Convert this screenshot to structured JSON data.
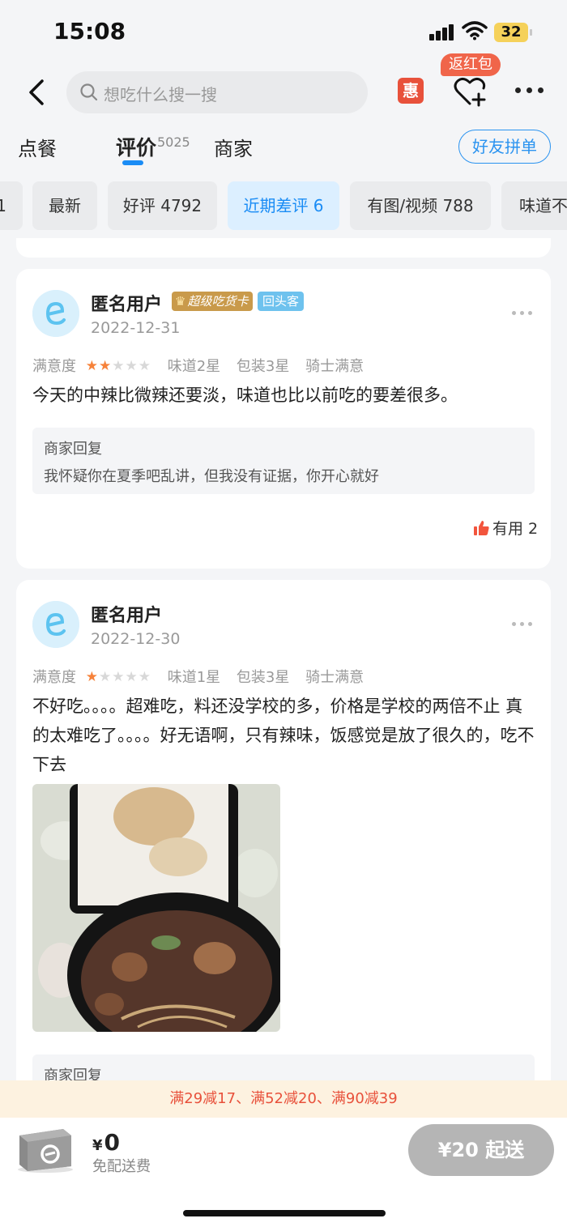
{
  "status": {
    "time": "15:08",
    "battery": "32"
  },
  "nav": {
    "search_placeholder": "想吃什么搜一搜",
    "hui_label": "惠",
    "red_packet_tag": "返红包"
  },
  "tabs": [
    {
      "label": "点餐"
    },
    {
      "label": "评价",
      "count": "5025",
      "active": true
    },
    {
      "label": "商家"
    }
  ],
  "friend_button": "好友拼单",
  "filters": [
    {
      "label": "1"
    },
    {
      "label": "最新"
    },
    {
      "label": "好评 4792"
    },
    {
      "label": "近期差评 6",
      "active": true
    },
    {
      "label": "有图/视频 788"
    },
    {
      "label": "味道不"
    }
  ],
  "reviews": [
    {
      "user": "匿名用户",
      "badge_super": "超级吃货卡",
      "badge_return": "回头客",
      "date": "2022-12-31",
      "satisfaction_label": "满意度",
      "stars": 2,
      "taste": "味道2星",
      "packaging": "包装3星",
      "rider": "骑士满意",
      "text": "今天的中辣比微辣还要淡，味道也比以前吃的要差很多。",
      "reply_title": "商家回复",
      "reply_text": "我怀疑你在夏季吧乱讲，但我没有证据，你开心就好",
      "useful": "有用 2"
    },
    {
      "user": "匿名用户",
      "date": "2022-12-30",
      "satisfaction_label": "满意度",
      "stars": 1,
      "taste": "味道1星",
      "packaging": "包装3星",
      "rider": "骑士满意",
      "text": "不好吃。。。。超难吃，料还没学校的多，价格是学校的两倍不止 真的太难吃了。。。。好无语啊，只有辣味，饭感觉是放了很久的，吃不下去",
      "reply_title": "商家回复"
    }
  ],
  "promo": "满29减17、满52减20、满90减39",
  "cart": {
    "currency": "¥",
    "amount": "0",
    "delivery": "免配送费",
    "checkout": "¥20 起送"
  }
}
